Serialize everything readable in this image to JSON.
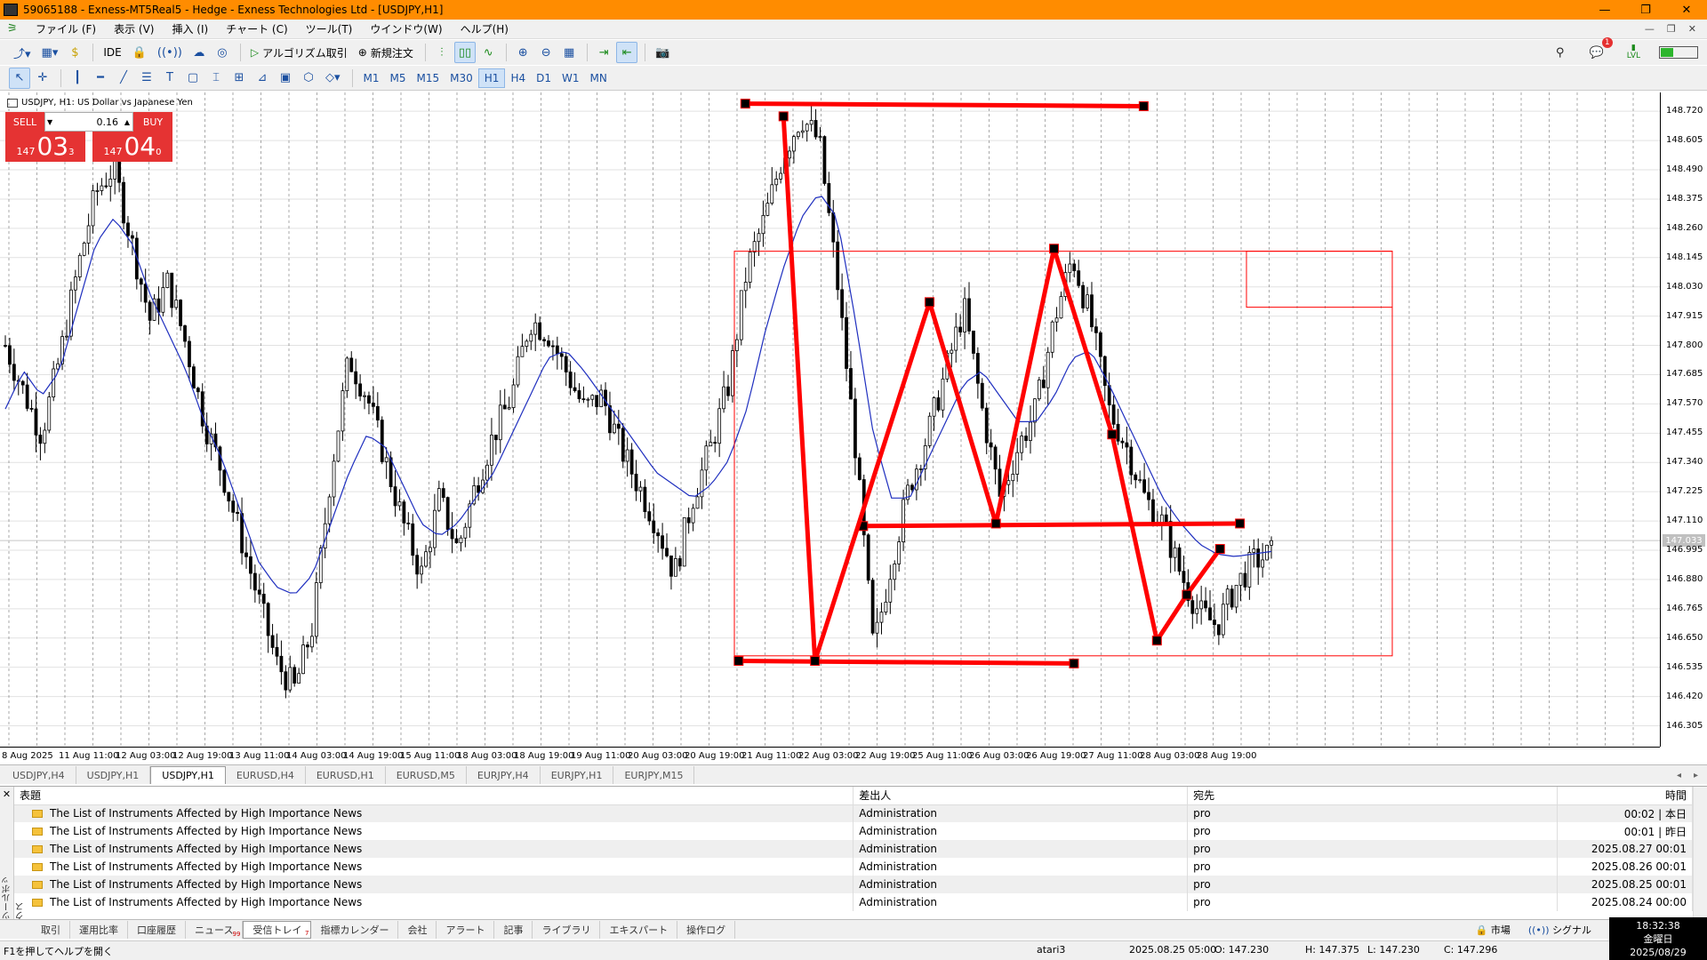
{
  "window": {
    "title": "59065188 - Exness-MT5Real5 - Hedge - Exness Technologies Ltd - [USDJPY,H1]",
    "controls": [
      "—",
      "❐",
      "✕"
    ]
  },
  "menu": {
    "items": [
      "ファイル (F)",
      "表示 (V)",
      "挿入 (I)",
      "チャート (C)",
      "ツール(T)",
      "ウインドウ(W)",
      "ヘルプ(H)"
    ],
    "mdi_controls": [
      "—",
      "❐",
      "✕"
    ]
  },
  "toolbar1": {
    "ide_label": "IDE",
    "algo_label": "アルゴリズム取引",
    "new_order_label": "新規注文",
    "notify_count": "1",
    "lvl_label": "LVL"
  },
  "timeframes": [
    "M1",
    "M5",
    "M15",
    "M30",
    "H1",
    "H4",
    "D1",
    "W1",
    "MN"
  ],
  "active_timeframe": "H1",
  "chart": {
    "header": "USDJPY, H1:  US Dollar vs Japanese Yen",
    "sell_label": "SELL",
    "buy_label": "BUY",
    "lot": "0.16",
    "bid_small": "147",
    "bid_big": "03",
    "bid_sup": "3",
    "ask_small": "147",
    "ask_big": "04",
    "ask_sup": "0",
    "current_price": "147.033",
    "colors": {
      "pattern": "#ff0000",
      "ma": "#1f2fbf",
      "candle": "#000000"
    }
  },
  "chart_data": {
    "type": "candlestick",
    "symbol": "USDJPY",
    "timeframe": "H1",
    "y_ticks": [
      148.72,
      148.605,
      148.49,
      148.375,
      148.26,
      148.145,
      148.03,
      147.915,
      147.8,
      147.685,
      147.57,
      147.455,
      147.34,
      147.225,
      147.11,
      146.995,
      146.88,
      146.765,
      146.65,
      146.535,
      146.42,
      146.305
    ],
    "y_tick_labels": [
      "148.720",
      "148.605",
      "148.490",
      "148.375",
      "148.260",
      "148.145",
      "148.030",
      "147.915",
      "147.800",
      "147.685",
      "147.570",
      "147.455",
      "147.340",
      "147.225",
      "147.110",
      "146.995",
      "146.880",
      "146.765",
      "146.650",
      "146.535",
      "146.420",
      "146.305"
    ],
    "ylim": [
      146.23,
      148.78
    ],
    "x_labels": [
      "8 Aug 2025",
      "11 Aug 11:00",
      "12 Aug 03:00",
      "12 Aug 19:00",
      "13 Aug 11:00",
      "14 Aug 03:00",
      "14 Aug 19:00",
      "15 Aug 11:00",
      "18 Aug 03:00",
      "18 Aug 19:00",
      "19 Aug 11:00",
      "20 Aug 03:00",
      "20 Aug 19:00",
      "21 Aug 11:00",
      "22 Aug 03:00",
      "22 Aug 19:00",
      "25 Aug 11:00",
      "26 Aug 03:00",
      "26 Aug 19:00",
      "27 Aug 11:00",
      "28 Aug 03:00",
      "28 Aug 19:00"
    ],
    "close_path": [
      147.8,
      147.62,
      147.45,
      147.75,
      148.1,
      148.4,
      148.5,
      148.2,
      147.9,
      148.05,
      147.8,
      147.5,
      147.3,
      147.05,
      146.8,
      146.55,
      146.45,
      146.7,
      147.3,
      147.75,
      147.6,
      147.35,
      147.1,
      146.9,
      147.2,
      147.0,
      147.25,
      147.45,
      147.6,
      147.9,
      147.85,
      147.7,
      147.55,
      147.6,
      147.4,
      147.25,
      147.1,
      146.9,
      147.2,
      147.4,
      147.65,
      148.1,
      148.3,
      148.55,
      148.7,
      148.6,
      148.05,
      147.4,
      146.6,
      146.95,
      147.25,
      147.45,
      147.7,
      147.95,
      147.55,
      147.2,
      147.4,
      147.55,
      147.9,
      148.15,
      147.9,
      147.55,
      147.4,
      147.2,
      147.1,
      146.9,
      146.75,
      146.7,
      146.85,
      146.95,
      146.98
    ],
    "ma_path": [
      147.55,
      147.7,
      147.6,
      147.7,
      147.95,
      148.2,
      148.3,
      148.2,
      148.0,
      147.85,
      147.7,
      147.5,
      147.35,
      147.15,
      146.95,
      146.85,
      146.82,
      146.9,
      147.1,
      147.3,
      147.45,
      147.4,
      147.25,
      147.1,
      147.05,
      147.1,
      147.2,
      147.3,
      147.45,
      147.6,
      147.75,
      147.78,
      147.7,
      147.6,
      147.5,
      147.4,
      147.3,
      147.25,
      147.2,
      147.25,
      147.35,
      147.55,
      147.85,
      148.1,
      148.3,
      148.4,
      148.3,
      147.9,
      147.45,
      147.2,
      147.2,
      147.35,
      147.5,
      147.65,
      147.7,
      147.6,
      147.5,
      147.5,
      147.6,
      147.75,
      147.78,
      147.65,
      147.5,
      147.35,
      147.2,
      147.1,
      147.02,
      146.98,
      146.97,
      146.98,
      146.99
    ],
    "pattern_zigzag": [
      [
        0.472,
        148.7
      ],
      [
        0.491,
        146.56
      ],
      [
        0.56,
        147.97
      ],
      [
        0.6,
        147.1
      ],
      [
        0.635,
        148.18
      ],
      [
        0.67,
        147.45
      ],
      [
        0.697,
        146.64
      ],
      [
        0.715,
        146.82
      ],
      [
        0.735,
        147.0
      ]
    ],
    "support_line": [
      [
        0.52,
        147.09
      ],
      [
        0.747,
        147.1
      ]
    ],
    "resistance_line_top": [
      [
        0.449,
        148.75
      ],
      [
        0.689,
        148.74
      ]
    ],
    "bottom_line": [
      [
        0.445,
        146.56
      ],
      [
        0.647,
        146.55
      ]
    ],
    "grid": true
  },
  "symbol_tabs": [
    "USDJPY,H4",
    "USDJPY,H1",
    "USDJPY,H1",
    "EURUSD,H4",
    "EURUSD,H1",
    "EURUSD,M5",
    "EURJPY,H4",
    "EURJPY,H1",
    "EURJPY,M15"
  ],
  "active_symbol_tab": 2,
  "toolbox": {
    "side_label": "ツールボックス",
    "columns": [
      "表題",
      "差出人",
      "宛先",
      "時間"
    ],
    "rows": [
      {
        "subject": "The List of Instruments Affected by High Importance News",
        "from": "Administration",
        "to": "pro",
        "time": "00:02 | 本日"
      },
      {
        "subject": "The List of Instruments Affected by High Importance News",
        "from": "Administration",
        "to": "pro",
        "time": "00:01 | 昨日"
      },
      {
        "subject": "The List of Instruments Affected by High Importance News",
        "from": "Administration",
        "to": "pro",
        "time": "2025.08.27 00:01"
      },
      {
        "subject": "The List of Instruments Affected by High Importance News",
        "from": "Administration",
        "to": "pro",
        "time": "2025.08.26 00:01"
      },
      {
        "subject": "The List of Instruments Affected by High Importance News",
        "from": "Administration",
        "to": "pro",
        "time": "2025.08.25 00:01"
      },
      {
        "subject": "The List of Instruments Affected by High Importance News",
        "from": "Administration",
        "to": "pro",
        "time": "2025.08.24 00:00"
      }
    ],
    "tabs": [
      "取引",
      "運用比率",
      "口座履歴",
      "ニュース",
      "受信トレイ",
      "指標カレンダー",
      "会社",
      "アラート",
      "記事",
      "ライブラリ",
      "エキスパート",
      "操作ログ"
    ],
    "tab_counts": {
      "3": "99",
      "4": "7"
    },
    "active_tab": 4,
    "market_label": "市場",
    "signal_label": "シグナル"
  },
  "statusbar": {
    "help": "F1を押してヘルプを開く",
    "profile": "atari3",
    "datetime": "2025.08.25 05:00",
    "open": "O: 147.230",
    "high": "H: 147.375",
    "low": "L: 147.230",
    "close": "C: 147.296"
  },
  "clock": {
    "time": "18:32:38",
    "day": "金曜日",
    "date": "2025/08/29"
  }
}
